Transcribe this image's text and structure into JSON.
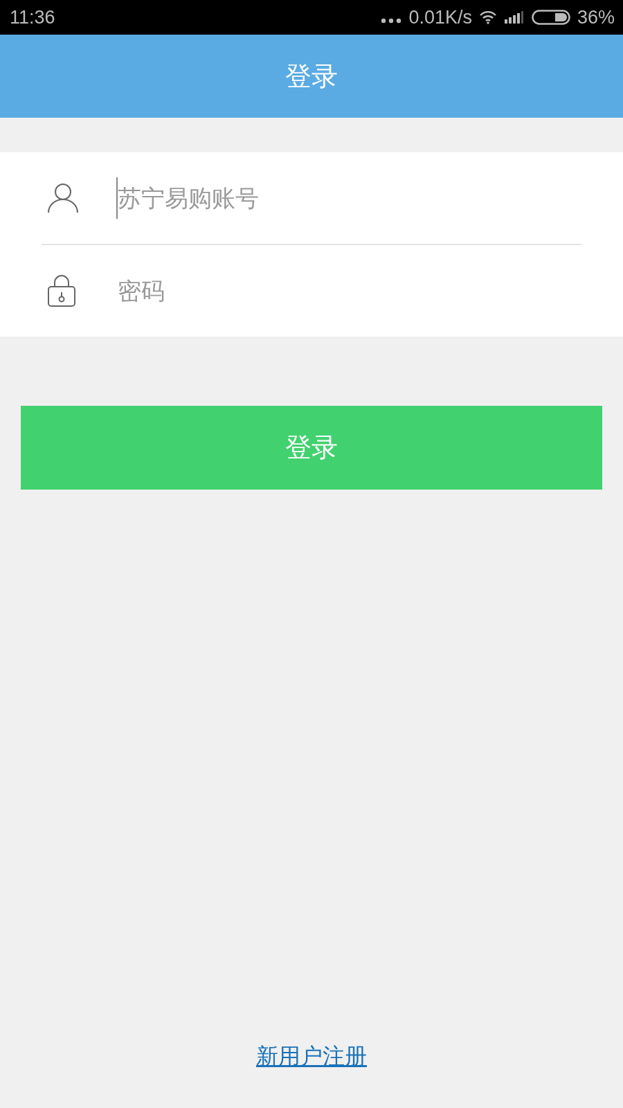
{
  "status_bar": {
    "time": "11:36",
    "network_speed": "0.01K/s",
    "battery": "36%"
  },
  "header": {
    "title": "登录"
  },
  "fields": [
    {
      "kind": "account",
      "placeholder": "苏宁易购账号",
      "focused": true
    },
    {
      "kind": "password",
      "placeholder": "密码",
      "focused": false
    }
  ],
  "login_button": {
    "label": "登录"
  },
  "register_link": {
    "label": "新用户注册"
  }
}
